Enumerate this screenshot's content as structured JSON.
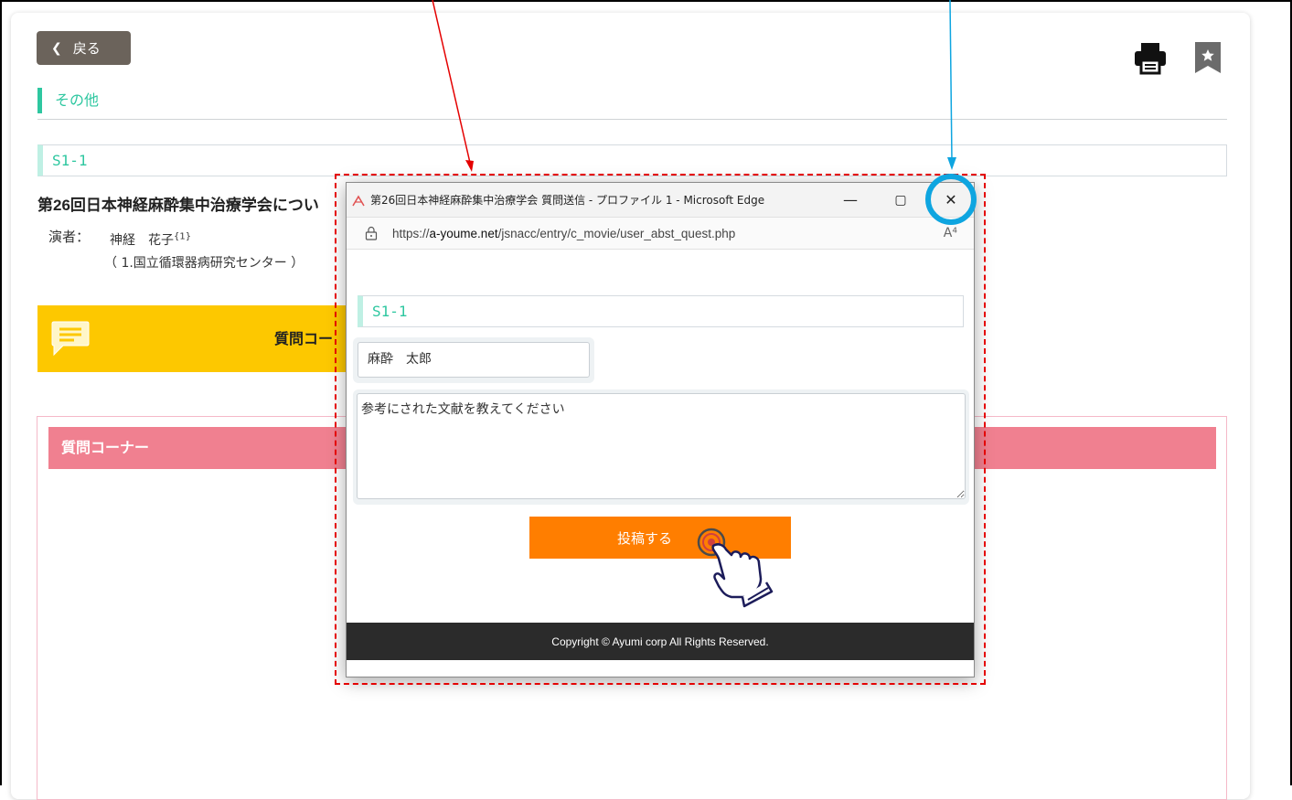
{
  "page": {
    "back_label": "戻る",
    "category": "その他",
    "session_code": "S1-1",
    "abstract_title": "第26回日本神経麻酔集中治療学会につい",
    "presenter_label": "演者：",
    "presenter_name": "神経　花子",
    "presenter_sup": "{1}",
    "affiliation": "（ 1.国立循環器病研究センター ）",
    "question_banner_label": "質問コー",
    "question_corner_title": "質問コーナー",
    "icons": [
      "chevron-left-icon",
      "print-icon",
      "bookmark-icon",
      "speech-bubble-icon"
    ]
  },
  "popup": {
    "window_title": "第26回日本神経麻酔集中治療学会 質問送信 - プロファイル 1 - Microsoft Edge",
    "url_prefix": "https://",
    "url_domain": "a-youme.net",
    "url_path": "/jsnacc/entry/c_movie/user_abst_quest.php",
    "read_aloud": "A⁴",
    "minimize": "—",
    "maximize": "▢",
    "close": "✕",
    "session_code": "S1-1",
    "name_value": "麻酔　太郎",
    "question_value": "参考にされた文献を教えてください",
    "submit_label": "投稿する",
    "copyright": "Copyright © Ayumi corp All Rights Reserved.",
    "icons": [
      "edge-app-icon",
      "lock-icon",
      "read-aloud-icon",
      "minimize-icon",
      "maximize-icon",
      "close-icon"
    ]
  },
  "annotations": {
    "colors": {
      "dashed_box": "#e40000",
      "close_highlight": "#0ea5e0"
    }
  }
}
